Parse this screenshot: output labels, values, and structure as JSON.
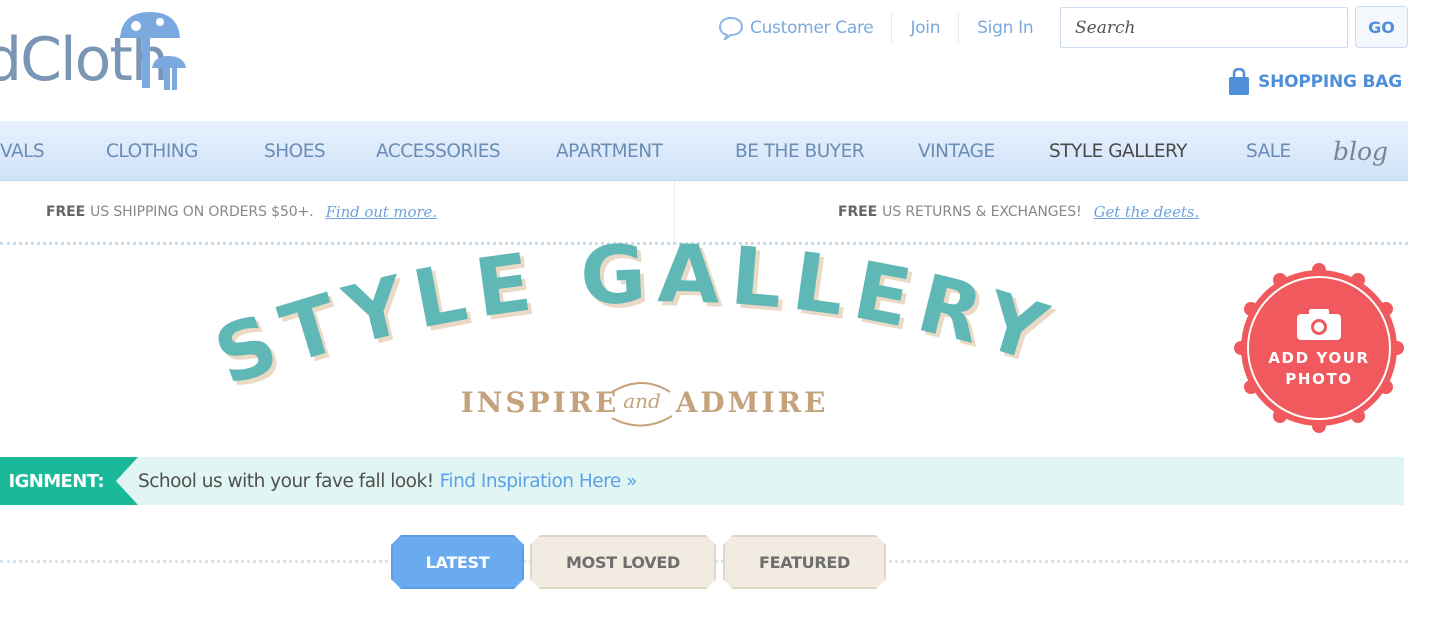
{
  "header": {
    "logo_text": "dCloth",
    "utility_links": [
      {
        "label": "Customer Care",
        "icon": "speech-bubble-icon"
      },
      {
        "label": "Join"
      },
      {
        "label": "Sign In"
      }
    ],
    "search": {
      "placeholder": "Search",
      "button_label": "GO"
    },
    "shopping_bag": {
      "label": "SHOPPING BAG",
      "icon": "shopping-bag-icon"
    }
  },
  "nav": {
    "items": [
      {
        "label": "VALS"
      },
      {
        "label": "CLOTHING"
      },
      {
        "label": "SHOES"
      },
      {
        "label": "ACCESSORIES"
      },
      {
        "label": "APARTMENT"
      },
      {
        "label": "BE THE BUYER"
      },
      {
        "label": "VINTAGE"
      },
      {
        "label": "STYLE GALLERY",
        "active": true
      },
      {
        "label": "SALE"
      },
      {
        "label": "blog"
      }
    ]
  },
  "promo": {
    "shipping": {
      "bold": "FREE",
      "text": "US SHIPPING ON ORDERS $50+.",
      "link": "Find out more."
    },
    "returns": {
      "bold": "FREE",
      "text": "US RETURNS & EXCHANGES!",
      "link": "Get the deets."
    }
  },
  "hero": {
    "title": "STYLE GALLERY",
    "subtitle_left": "INSPIRE",
    "subtitle_mid": "and",
    "subtitle_right": "ADMIRE"
  },
  "add_photo": {
    "label": "ADD YOUR PHOTO",
    "icon": "camera-icon"
  },
  "assignment": {
    "tag": "IGNMENT:",
    "text": "School us with your fave fall look!",
    "link": "Find Inspiration Here »"
  },
  "tabs": [
    {
      "label": "LATEST",
      "active": true
    },
    {
      "label": "MOST LOVED",
      "active": false
    },
    {
      "label": "FEATURED",
      "active": false
    }
  ],
  "colors": {
    "accent_blue": "#4f8fd9",
    "nav_bg": "#d6e7fa",
    "teal": "#5fb7b6",
    "gold": "#c3a27c",
    "badge_red": "#f05a5e",
    "assign_green": "#19b99a",
    "assign_bg": "#e1f5f2",
    "tab_active": "#6aabf0",
    "tab_inactive": "#f2ebe1"
  }
}
